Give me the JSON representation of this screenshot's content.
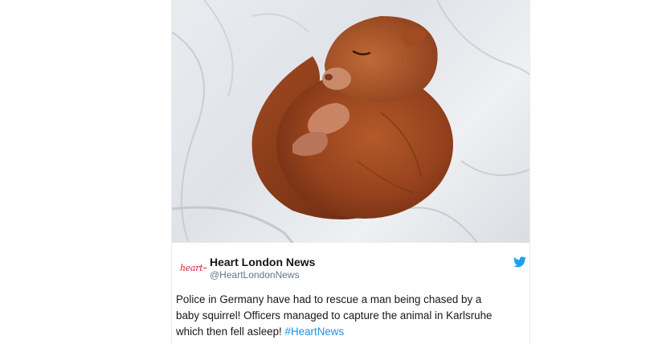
{
  "tweet": {
    "image_icon": "sleeping-squirrel-photo",
    "logo_text": "heart",
    "logo_color": "#d3202f",
    "account_name": "Heart London News",
    "handle": "@HeartLondonNews",
    "platform_icon": "twitter-bird-icon",
    "platform_color": "#1da1f2",
    "text_lines": [
      "Police in Germany have had to rescue a man being chased by a",
      "baby squirrel! Officers managed to capture the animal in Karlsruhe",
      "which then fell asleep!"
    ],
    "hashtag": "#HeartNews",
    "hashtag_color": "#1b95e0"
  }
}
